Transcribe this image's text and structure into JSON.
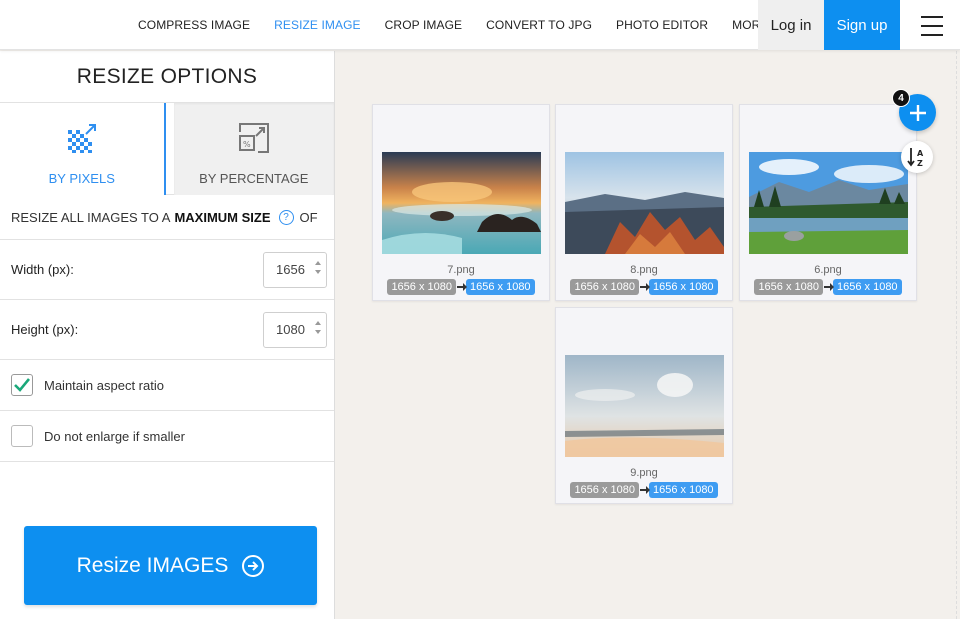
{
  "nav": {
    "items": [
      "COMPRESS IMAGE",
      "RESIZE IMAGE",
      "CROP IMAGE",
      "CONVERT TO JPG",
      "PHOTO EDITOR",
      "MORE TOOLS"
    ],
    "active": "RESIZE IMAGE",
    "login": "Log in",
    "signup": "Sign up"
  },
  "panel": {
    "title": "RESIZE OPTIONS",
    "tabs": [
      {
        "label": "BY PIXELS",
        "icon": "pixels-resize-icon",
        "active": true
      },
      {
        "label": "BY PERCENTAGE",
        "icon": "percentage-resize-icon",
        "active": false
      }
    ],
    "resize_all": {
      "prefix": "RESIZE ALL IMAGES TO A",
      "bold": "MAXIMUM SIZE",
      "help": "?",
      "suffix": "OF"
    },
    "width": {
      "label": "Width (px):",
      "value": "1656"
    },
    "height": {
      "label": "Height (px):",
      "value": "1080"
    },
    "maintain_aspect": {
      "label": "Maintain aspect ratio",
      "checked": true
    },
    "no_enlarge": {
      "label": "Do not enlarge if smaller",
      "checked": false
    },
    "resize_button": "Resize IMAGES"
  },
  "workspace": {
    "image_count": "4",
    "images": [
      {
        "name": "7.png",
        "original": "1656 x 1080",
        "new": "1656 x 1080",
        "scene": "sunset-beach"
      },
      {
        "name": "8.png",
        "original": "1656 x 1080",
        "new": "1656 x 1080",
        "scene": "red-canyon"
      },
      {
        "name": "6.png",
        "original": "1656 x 1080",
        "new": "1656 x 1080",
        "scene": "mountain-lake"
      },
      {
        "name": "9.png",
        "original": "1656 x 1080",
        "new": "1656 x 1080",
        "scene": "misty-sky"
      }
    ]
  },
  "colors": {
    "accent": "#0d8ff0",
    "active_text": "#2f8ff0",
    "workspace_bg": "#f3f0ec"
  }
}
